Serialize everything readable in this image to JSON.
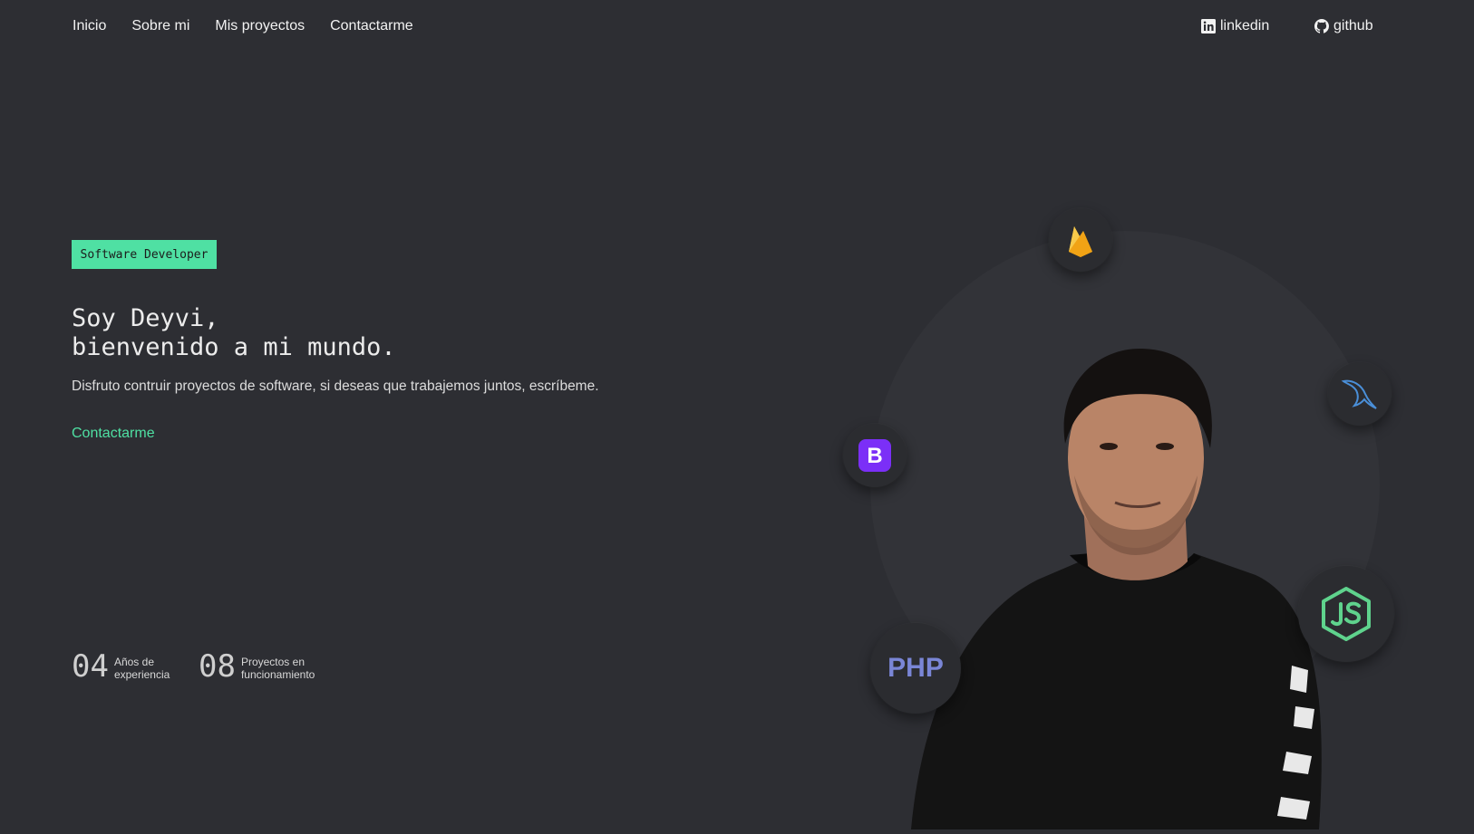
{
  "nav": {
    "links": [
      {
        "label": "Inicio"
      },
      {
        "label": "Sobre mi"
      },
      {
        "label": "Mis proyectos"
      },
      {
        "label": "Contactarme"
      }
    ],
    "social": {
      "linkedin": {
        "label": "linkedin",
        "icon": "linkedin-icon"
      },
      "github": {
        "label": "github",
        "icon": "github-icon"
      }
    }
  },
  "hero": {
    "badge": "Software Developer",
    "headline_line1": "Soy Deyvi,",
    "headline_line2": "bienvenido a mi mundo.",
    "subtitle": "Disfruto contruir proyectos de software, si deseas que trabajemos juntos, escríbeme.",
    "cta": "Contactarme"
  },
  "stats": [
    {
      "number": "04",
      "label_line1": "Años de",
      "label_line2": "experiencia"
    },
    {
      "number": "08",
      "label_line1": "Proyectos en",
      "label_line2": "funcionamiento"
    }
  ],
  "tech_icons": {
    "firebase": "firebase-icon",
    "mysql": "mysql-icon",
    "bootstrap": "bootstrap-icon",
    "php": "PHP",
    "nodejs": "nodejs-icon"
  },
  "colors": {
    "background": "#2d2e33",
    "accent": "#4fe0a3",
    "bootstrap": "#7b2ff7",
    "php": "#7a86d6",
    "node": "#5fd38d",
    "mysql": "#4a8fd8",
    "firebase": "#f5b31d"
  }
}
